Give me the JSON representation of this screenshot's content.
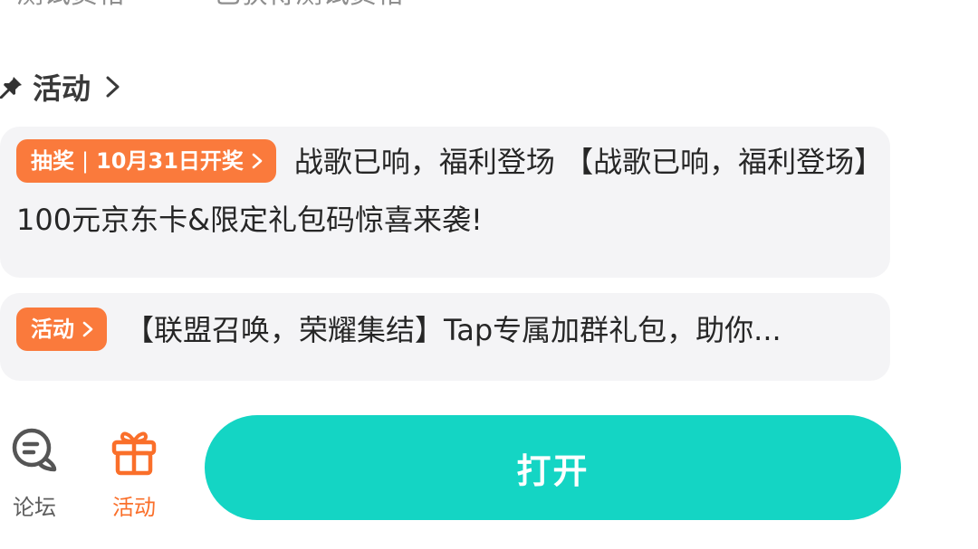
{
  "top_partial": {
    "left_text": "测试资格",
    "right_text": "已获得测试资格"
  },
  "section": {
    "title": "活动"
  },
  "cards": [
    {
      "tag_label": "抽奖",
      "tag_sep": "|",
      "tag_date": "10月31日开奖",
      "text": "战歌已响，福利登场 【战歌已响，福利登场】100元京东卡&限定礼包码惊喜来袭!"
    },
    {
      "tag_label": "活动",
      "text": "【联盟召唤，荣耀集结】Tap专属加群礼包，助你..."
    }
  ],
  "bottom_nav": {
    "forum_label": "论坛",
    "activity_label": "活动",
    "open_button_label": "打开"
  },
  "colors": {
    "accent_orange": "#fa7a3c",
    "button_teal": "#14d5c4",
    "card_bg": "#f4f4f6"
  },
  "icons": {
    "pin": "pin-icon",
    "chevron": "chevron-right-icon",
    "forum": "chat-bubble-icon",
    "activity": "gift-icon"
  }
}
